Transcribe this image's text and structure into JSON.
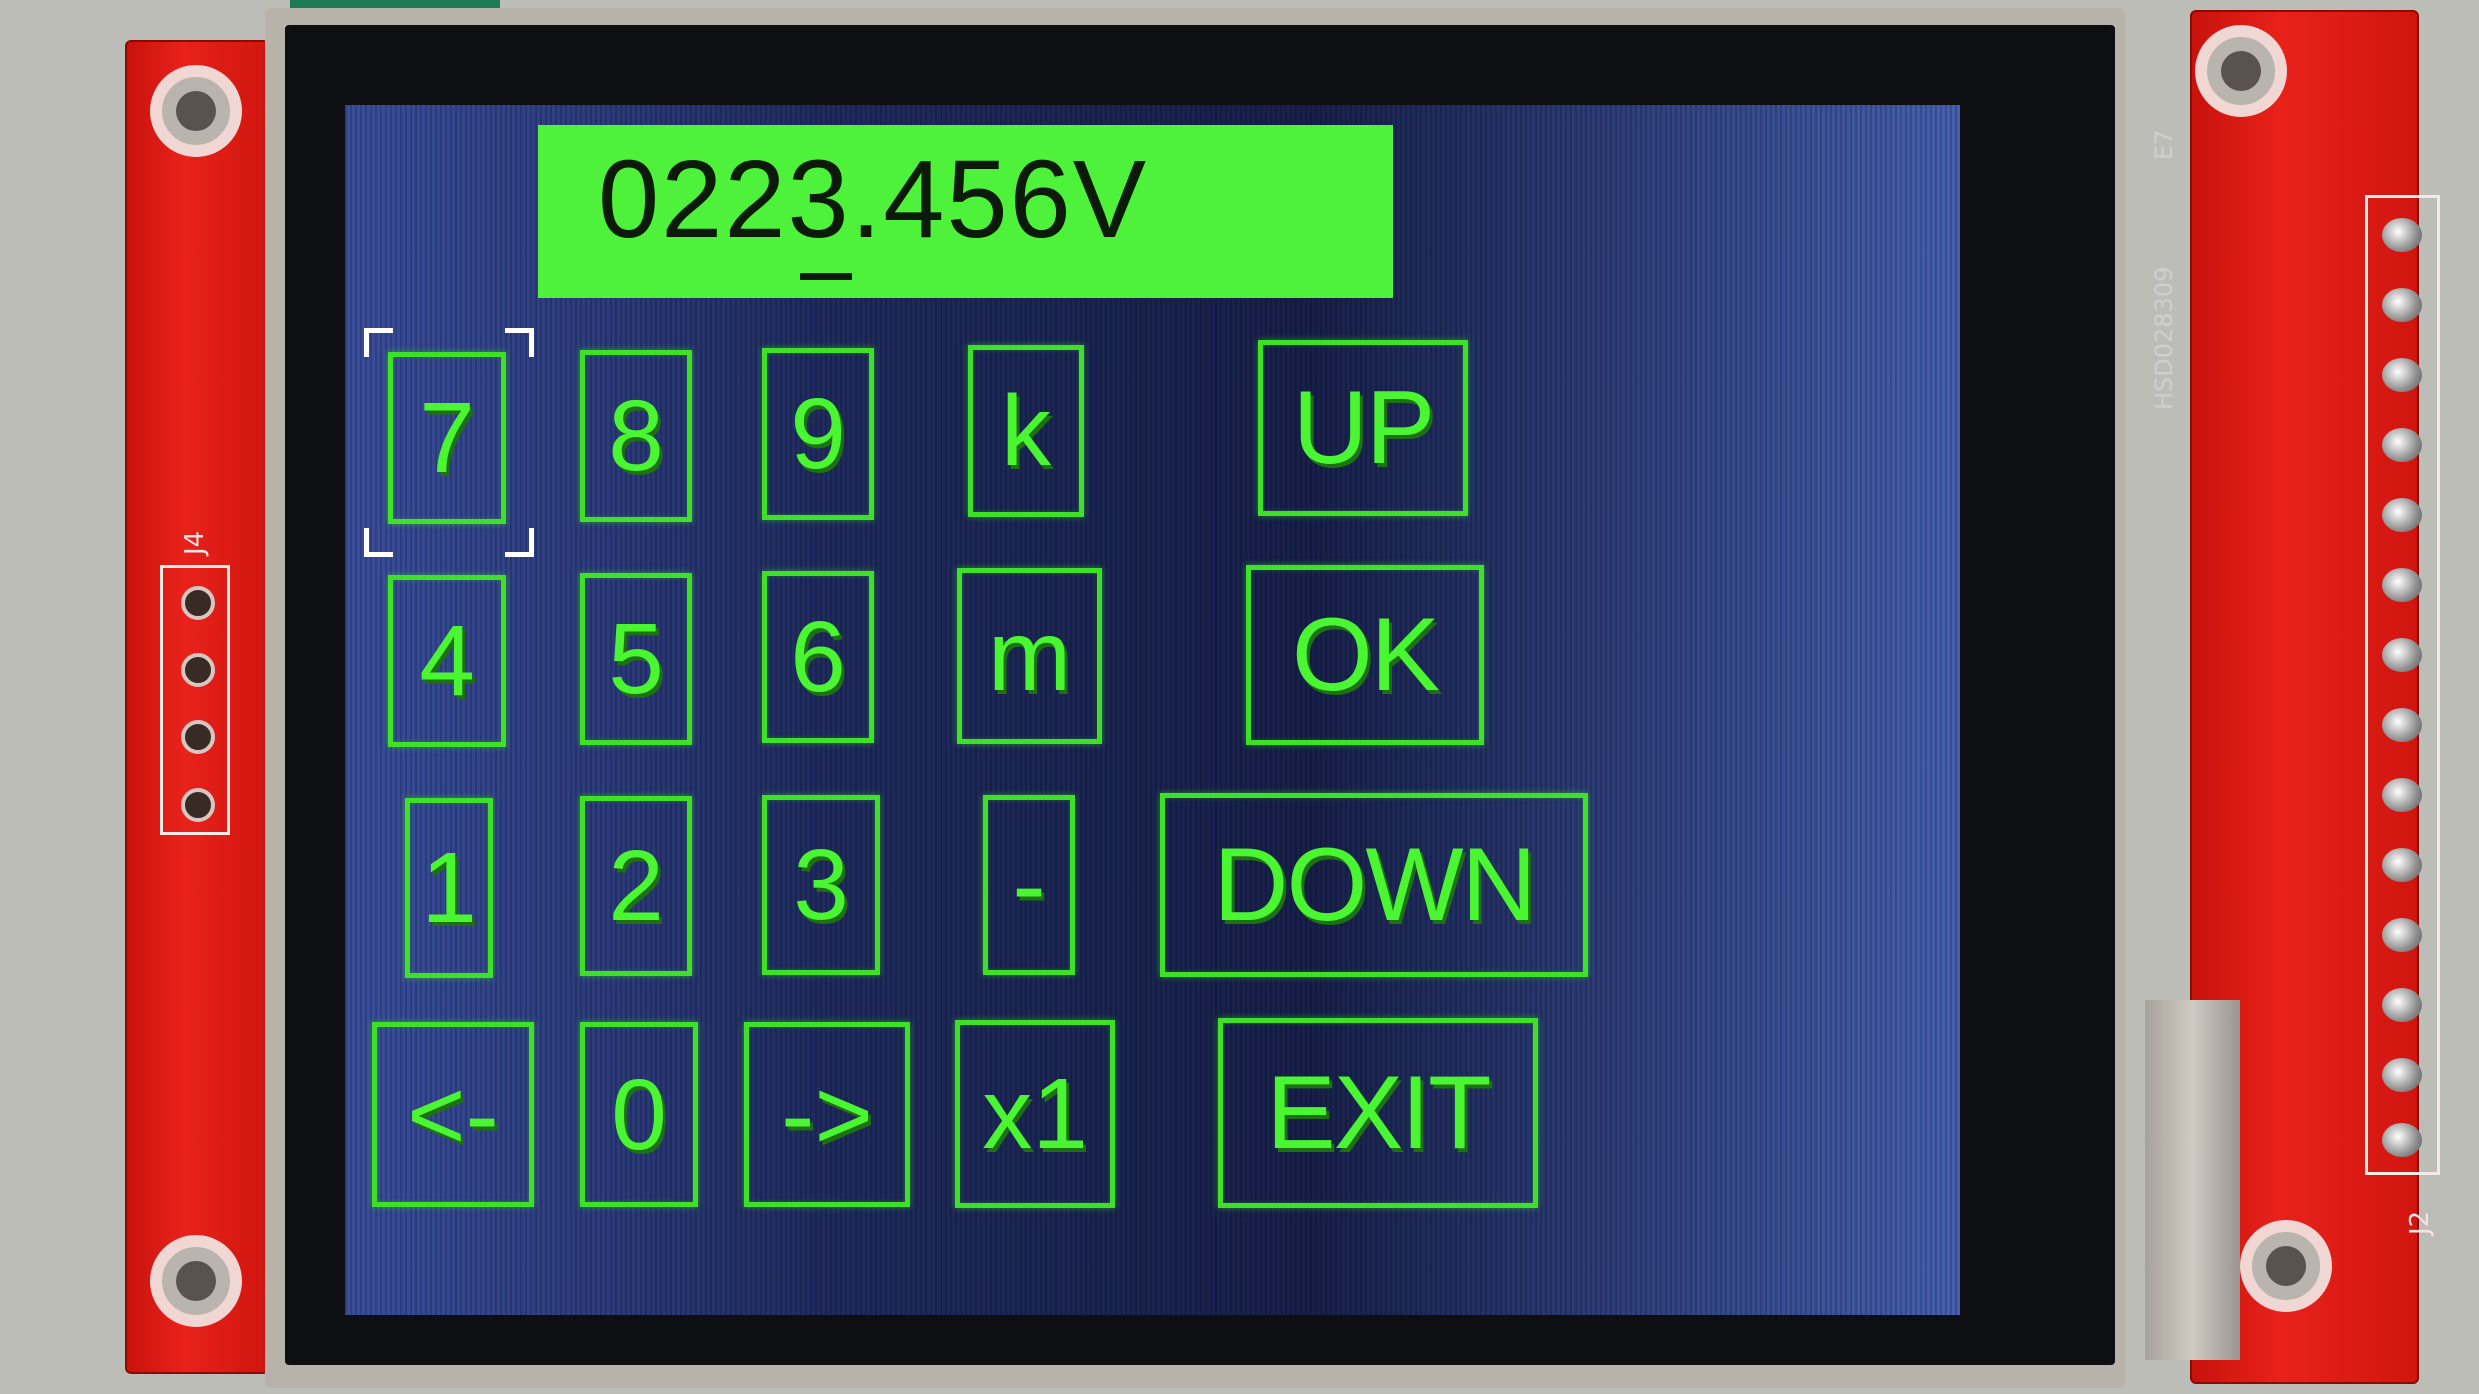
{
  "display": {
    "value": "0223.456V",
    "background": "#4ef23a",
    "text_color": "#0c1a0a"
  },
  "selected_key": "7",
  "accent_color": "#3ee028",
  "keypad": {
    "row1": [
      "7",
      "8",
      "9",
      "k",
      "UP"
    ],
    "row2": [
      "4",
      "5",
      "6",
      "m",
      "OK"
    ],
    "row3": [
      "1",
      "2",
      "3",
      "-",
      "DOWN"
    ],
    "row4": [
      "<-",
      "0",
      "->",
      "x1",
      "EXIT"
    ]
  },
  "board": {
    "left_header_label": "J4",
    "right_header_label": "J2",
    "silkscreen": "HSD028309",
    "silkscreen_code": "E7"
  }
}
